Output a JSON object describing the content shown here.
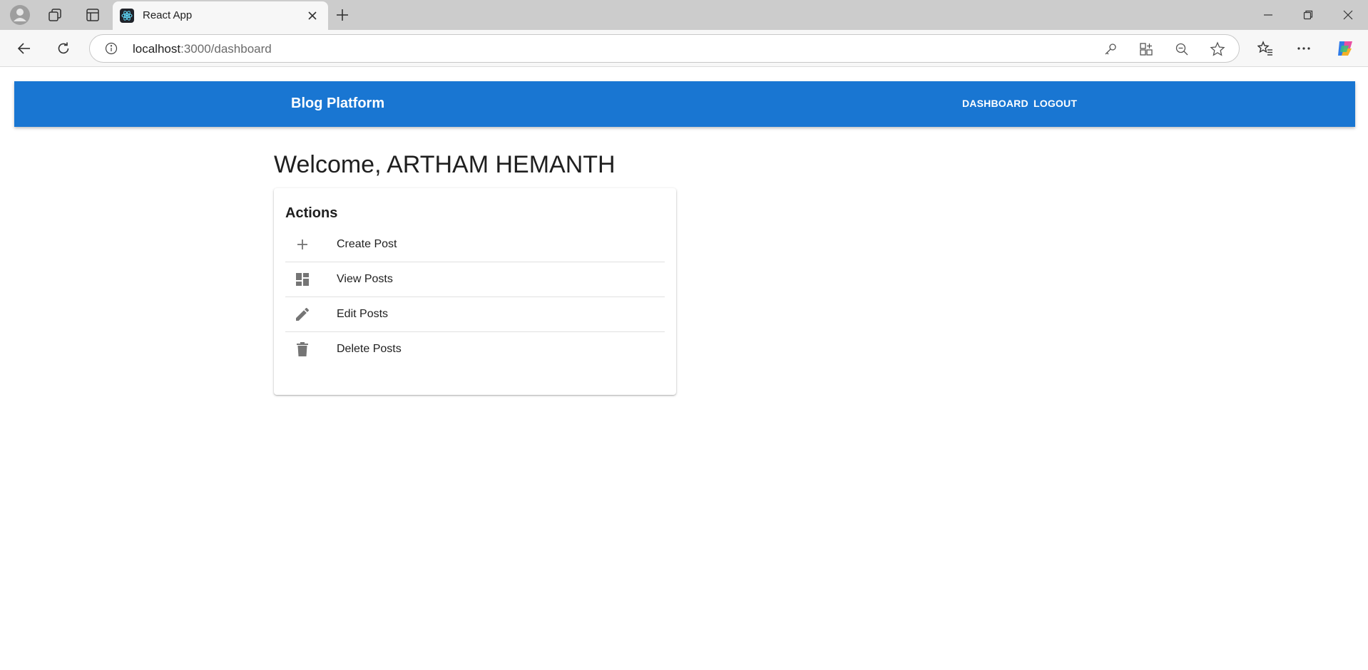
{
  "browser": {
    "tab_title": "React App",
    "url_host": "localhost",
    "url_path": ":3000/dashboard"
  },
  "app": {
    "brand": "Blog Platform",
    "nav": {
      "dashboard": "DASHBOARD",
      "logout": "LOGOUT"
    },
    "welcome": "Welcome, ARTHAM HEMANTH",
    "card_title": "Actions",
    "actions": [
      {
        "label": "Create Post",
        "icon": "add-icon"
      },
      {
        "label": "View Posts",
        "icon": "dashboard-icon"
      },
      {
        "label": "Edit Posts",
        "icon": "edit-icon"
      },
      {
        "label": "Delete Posts",
        "icon": "delete-icon"
      }
    ],
    "colors": {
      "primary": "#1976d2",
      "icon": "#757575"
    }
  }
}
